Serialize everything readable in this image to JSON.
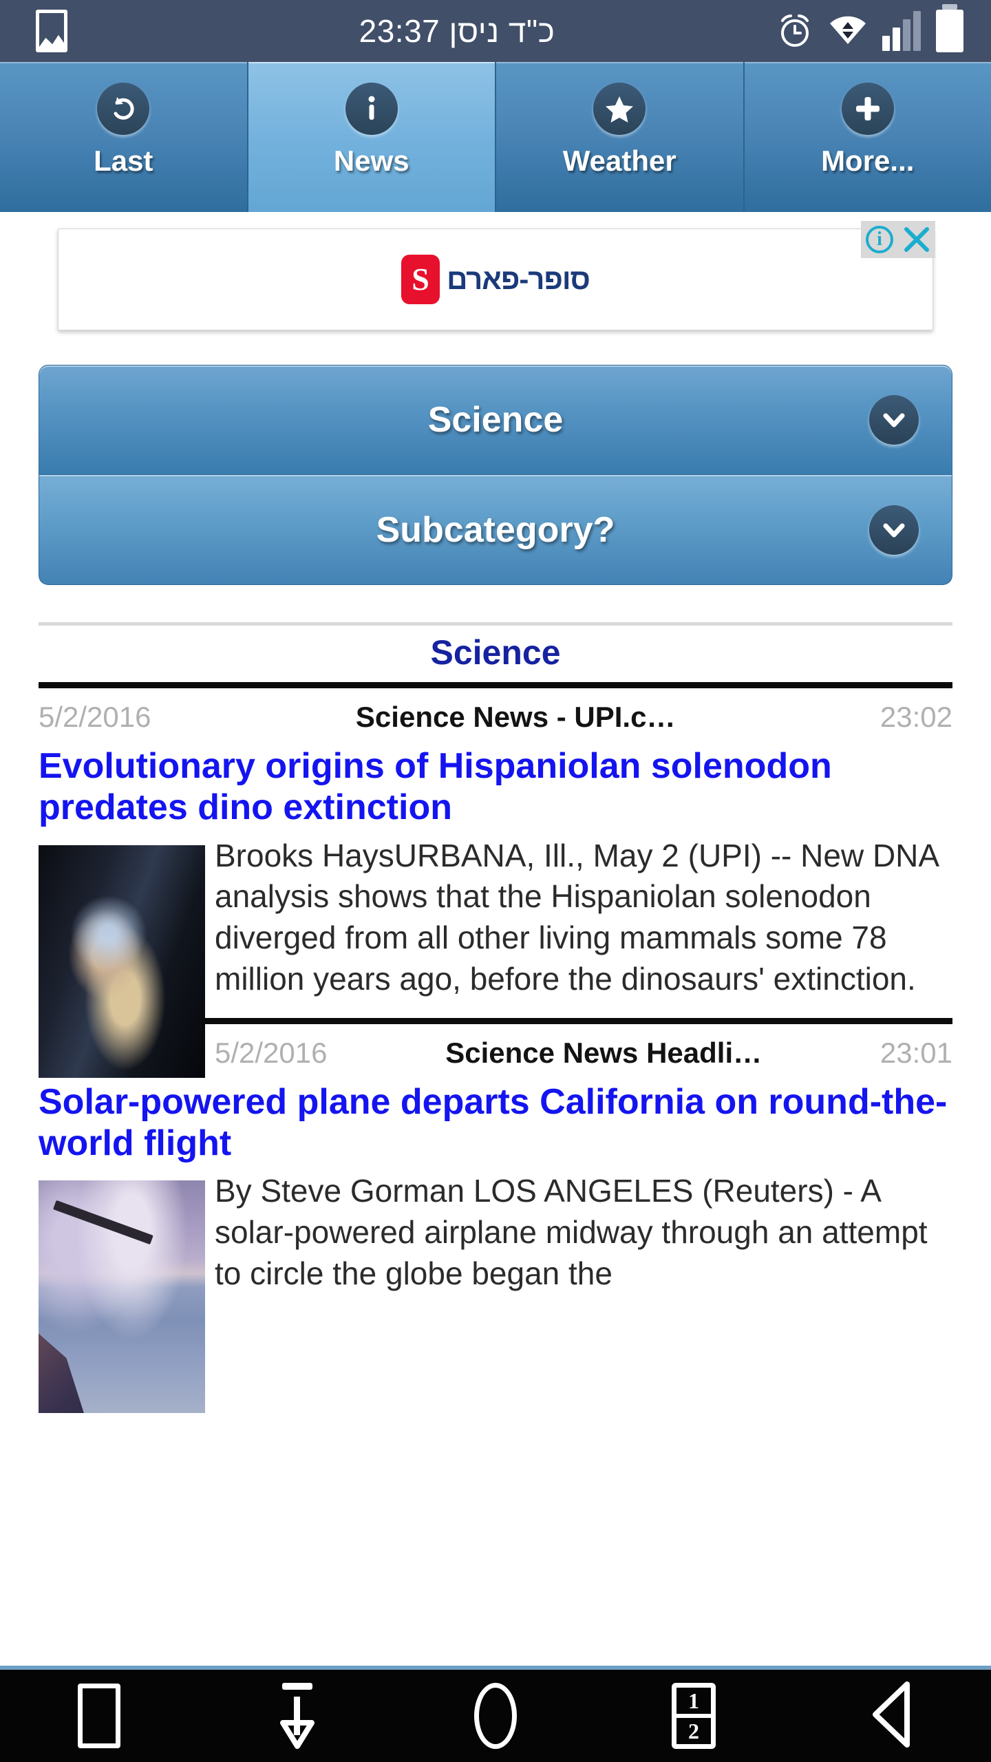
{
  "status_bar": {
    "left_icon": "gallery-icon",
    "center_text": "כ\"ד ניסן 23:37",
    "right_icons": [
      "alarm-icon",
      "wifi-transfer-icon",
      "signal-bars-icon",
      "battery-icon"
    ],
    "signal_bars_filled": 2,
    "signal_bars_total": 4,
    "background_color": "#414f69"
  },
  "tabs": [
    {
      "label": "Last",
      "icon": "undo-arrow-icon",
      "active": false
    },
    {
      "label": "News",
      "icon": "info-icon",
      "active": true
    },
    {
      "label": "Weather",
      "icon": "star-icon",
      "active": false
    },
    {
      "label": "More...",
      "icon": "plus-icon",
      "active": false
    }
  ],
  "ad": {
    "advertiser": "סופר-פארם",
    "logo_mark": "S",
    "logo_color": "#e8112d",
    "text_color": "#1b3a7a",
    "info_icon": "adchoices-info-icon",
    "close_icon": "close-icon",
    "close_label": "✕",
    "info_label": "i"
  },
  "filters": {
    "category": {
      "label": "Science",
      "chevron": "chevron-down-icon"
    },
    "subcategory": {
      "label": "Subcategory?",
      "chevron": "chevron-down-icon"
    }
  },
  "section": {
    "title": "Science"
  },
  "articles": [
    {
      "date": "5/2/2016",
      "source": "Science News - UPI.c…",
      "time": "23:02",
      "headline": "Evolutionary origins of Hispaniolan solenodon predates dino extinction",
      "body": "Brooks HaysURBANA, Ill., May 2 (UPI) -- New DNA analysis shows that the Hispaniolan solenodon diverged from all other living mammals some 78 million years ago, before the dinosaurs' extinction.",
      "thumb_class": "solenodon",
      "thumb_alt": "researcher-with-solenodon-photo"
    },
    {
      "date": "5/2/2016",
      "source": "Science News Headli…",
      "time": "23:01",
      "headline": "Solar-powered plane departs California on round-the-world flight",
      "body": "By Steve Gorman LOS ANGELES (Reuters) - A solar-powered airplane midway through an attempt to circle the globe began the",
      "thumb_class": "plane",
      "thumb_alt": "solar-plane-over-water-photo"
    }
  ],
  "nav_bar": {
    "buttons": [
      {
        "name": "recents-button",
        "icon": "square-icon"
      },
      {
        "name": "download-button",
        "icon": "download-arrow-icon"
      },
      {
        "name": "home-button",
        "icon": "circle-icon"
      },
      {
        "name": "multiwindow-button",
        "icon": "split-window-icon",
        "top": "1",
        "bottom": "2"
      },
      {
        "name": "back-button",
        "icon": "back-triangle-icon"
      }
    ]
  },
  "colors": {
    "status_bar": "#414f69",
    "tab_active": "#74b2dd",
    "tab_inactive": "#4a85b6",
    "headline_blue": "#1414f0",
    "section_blue": "#1622a0",
    "nav_bar": "#050505"
  }
}
